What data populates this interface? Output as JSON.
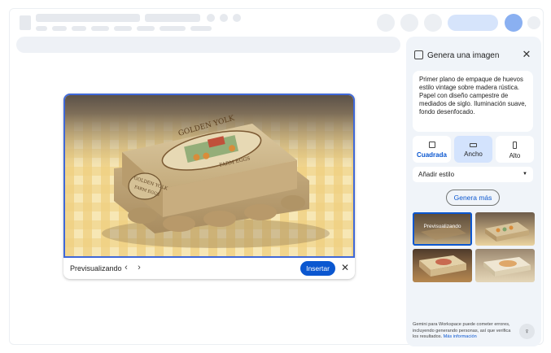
{
  "preview": {
    "label": "Previsualizando",
    "prev_icon": "‹",
    "next_icon": "›",
    "insert_label": "Insertar",
    "close_icon": "✕",
    "product_text": {
      "line1": "GOLDEN YOLK",
      "line2": "FARM EGGS"
    }
  },
  "panel": {
    "title": "Genera una imagen",
    "close_icon": "✕",
    "prompt": "Primer plano de empaque de huevos estilo vintage sobre madera rústica. Papel con diseño campestre de mediados de siglo. Iluminación suave, fondo desenfocado.",
    "aspect_options": [
      {
        "label": "Cuadrada",
        "selected": false
      },
      {
        "label": "Ancho",
        "selected": true
      },
      {
        "label": "Alto",
        "selected": false
      }
    ],
    "style_label": "Añadir estilo",
    "style_caret": "▼",
    "more_label": "Genera más",
    "thumbnail_overlay": "Previsualizando",
    "disclaimer": "Gemini para Workspace puede cometer errores, incluyendo generando personas, así que verifica los resultados.",
    "disclaimer_link": "Más información",
    "bulb_icon": "♀"
  },
  "colors": {
    "accent": "#0b57d0",
    "selected_aspect": "#d3e3fd",
    "panel_bg": "#f0f4f9",
    "preview_border": "#3f68d8"
  }
}
